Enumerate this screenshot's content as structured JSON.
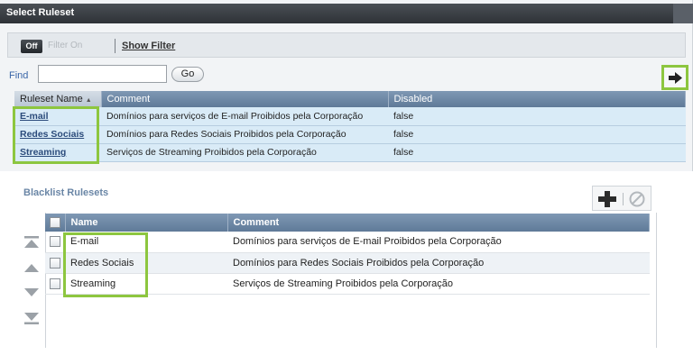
{
  "window": {
    "title": "Select Ruleset"
  },
  "filter_bar": {
    "off_label": "Off",
    "on_label": "Filter On",
    "show_filter_label": "Show Filter"
  },
  "find": {
    "label": "Find",
    "value": "",
    "go_label": "Go"
  },
  "ruleset_table": {
    "columns": [
      "Ruleset Name",
      "Comment",
      "Disabled"
    ],
    "sort_indicator": "▲",
    "rows": [
      {
        "name": "E-mail",
        "comment": "Domínios para serviços de E-mail Proibidos pela Corporação",
        "disabled": "false"
      },
      {
        "name": "Redes Sociais",
        "comment": "Domínios para Redes Sociais Proibidos pela Corporação",
        "disabled": "false"
      },
      {
        "name": "Streaming",
        "comment": "Serviços de Streaming Proibidos pela Corporação",
        "disabled": "false"
      }
    ]
  },
  "blacklist": {
    "title": "Blacklist Rulesets",
    "columns": [
      "Name",
      "Comment"
    ],
    "rows": [
      {
        "name": "E-mail",
        "comment": "Domínios para serviços de E-mail Proibidos pela Corporação"
      },
      {
        "name": "Redes Sociais",
        "comment": "Domínios para Redes Sociais Proibidos pela Corporação"
      },
      {
        "name": "Streaming",
        "comment": "Serviços de Streaming Proibidos pela Corporação"
      }
    ]
  },
  "icons": {
    "add_arrow": "right-arrow-icon",
    "add": "plus-icon",
    "remove": "cancel-circle-icon",
    "move_top": "move-to-top-icon",
    "move_up": "move-up-icon",
    "move_down": "move-down-icon",
    "move_bottom": "move-to-bottom-icon"
  },
  "colors": {
    "highlight": "#8dc63f",
    "header": "#6b86a4",
    "selected_row": "#d9ebf7"
  }
}
